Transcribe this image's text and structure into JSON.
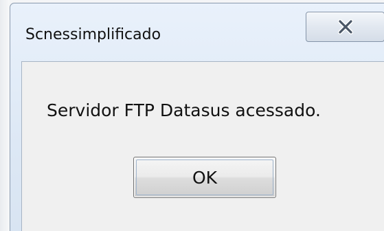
{
  "window": {
    "title": "Scnessimplificado",
    "close_icon": "close-icon"
  },
  "dialog": {
    "message": "Servidor FTP Datasus acessado.",
    "ok_label": "OK"
  }
}
